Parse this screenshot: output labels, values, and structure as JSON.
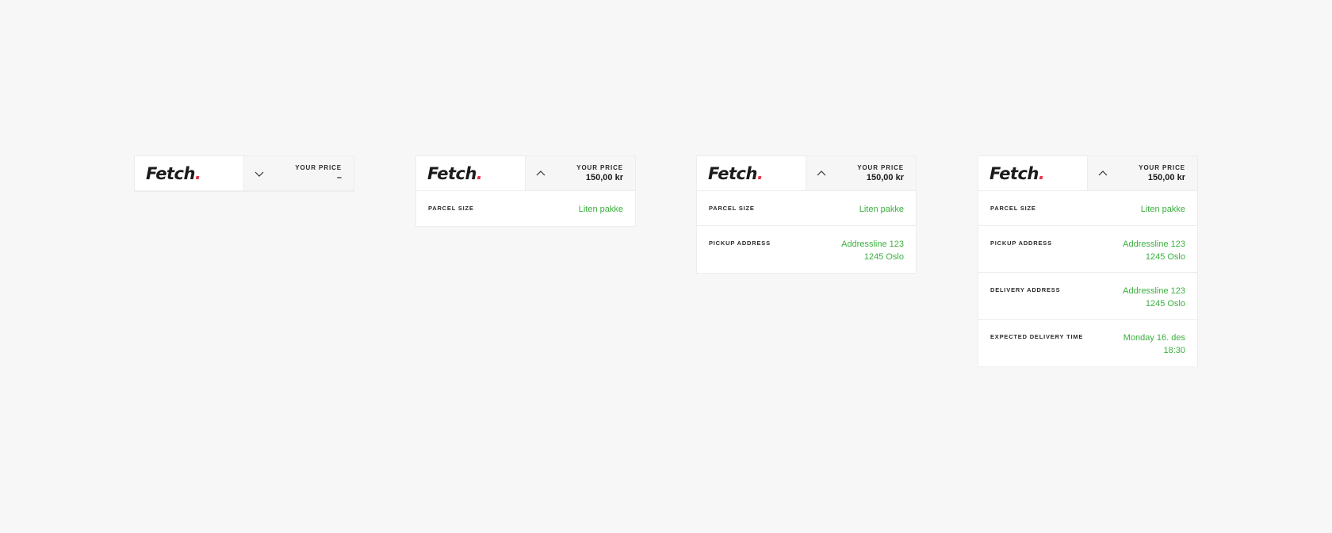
{
  "brand": {
    "logo_text": "Fetch",
    "logo_dot": ".",
    "accent_color": "#3bb03f",
    "dot_color": "#e8334a"
  },
  "widgets": [
    {
      "state": "collapsed",
      "toggle_icon": "chevron-down-icon",
      "price_label": "YOUR PRICE",
      "price_value": "–",
      "rows": []
    },
    {
      "state": "expanded",
      "toggle_icon": "chevron-up-icon",
      "price_label": "YOUR PRICE",
      "price_value": "150,00 kr",
      "rows": [
        {
          "label": "PARCEL SIZE",
          "value": [
            "Liten pakke"
          ]
        }
      ]
    },
    {
      "state": "expanded",
      "toggle_icon": "chevron-up-icon",
      "price_label": "YOUR PRICE",
      "price_value": "150,00 kr",
      "rows": [
        {
          "label": "PARCEL SIZE",
          "value": [
            "Liten pakke"
          ]
        },
        {
          "label": "PICKUP ADDRESS",
          "value": [
            "Addressline 123",
            "1245 Oslo"
          ]
        }
      ]
    },
    {
      "state": "expanded",
      "toggle_icon": "chevron-up-icon",
      "price_label": "YOUR PRICE",
      "price_value": "150,00 kr",
      "rows": [
        {
          "label": "PARCEL SIZE",
          "value": [
            "Liten pakke"
          ]
        },
        {
          "label": "PICKUP ADDRESS",
          "value": [
            "Addressline 123",
            "1245 Oslo"
          ]
        },
        {
          "label": "DELIVERY ADDRESS",
          "value": [
            "Addressline 123",
            "1245 Oslo"
          ]
        },
        {
          "label": "EXPECTED DELIVERY TIME",
          "value": [
            "Monday 16. des",
            "18:30"
          ]
        }
      ]
    }
  ]
}
